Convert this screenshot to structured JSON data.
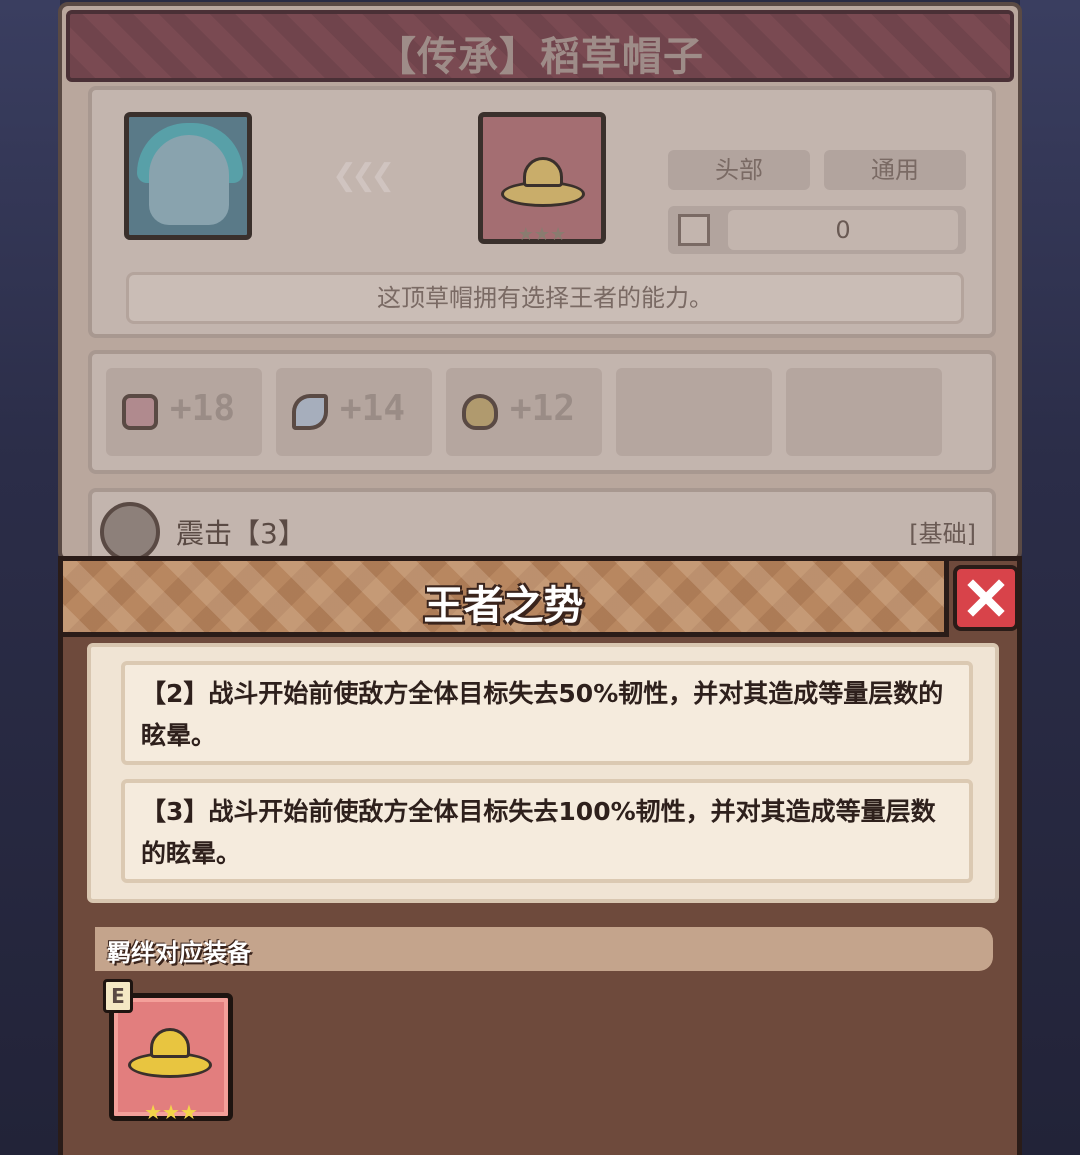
{
  "item_panel": {
    "title": "【传承】稻草帽子",
    "slot_labels": [
      "头部",
      "通用"
    ],
    "stat_value": "0",
    "description": "这顶草帽拥有选择王者的能力。",
    "attributes": [
      {
        "icon": "defense-icon",
        "value": "+18"
      },
      {
        "icon": "wing-icon",
        "value": "+14"
      },
      {
        "icon": "horseshoe-icon",
        "value": "+12"
      }
    ],
    "skill": {
      "name": "震击【3】",
      "tag": "[基础]"
    }
  },
  "popup": {
    "title": "王者之势",
    "effects": [
      {
        "level": "【2】",
        "text": "战斗开始前使敌方全体目标失去50%韧性，并对其造成等量层数的眩晕。"
      },
      {
        "level": "【3】",
        "text": "战斗开始前使敌方全体目标失去100%韧性，并对其造成等量层数的眩晕。"
      }
    ],
    "bond_title": "羁绊对应装备",
    "bond_item": {
      "grade": "E",
      "icon": "straw-hat-icon",
      "stars": "★★★"
    }
  },
  "colors": {
    "popup_bg": "#6e4a3c",
    "header_bg": "#b88760",
    "close_bg": "#d8434a",
    "effect_bg": "#f0e4d4"
  }
}
